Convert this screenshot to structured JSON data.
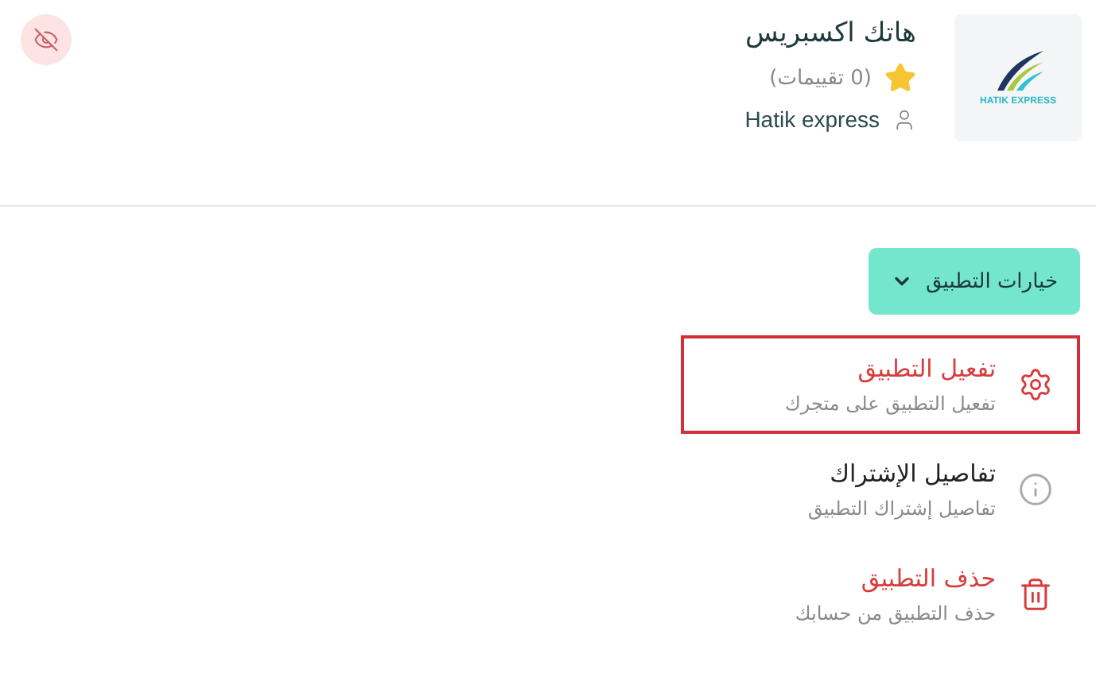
{
  "app": {
    "name": "هاتك اكسبريس",
    "logo_text": "HATIK EXPRESS",
    "stars": 1,
    "rating_text": "(0 تقييمات)",
    "developer": "Hatik express",
    "hidden": true
  },
  "options_button": {
    "label": "خيارات التطبيق",
    "expanded": true
  },
  "menu": [
    {
      "kind": "activate",
      "title": "تفعيل التطبيق",
      "subtitle": "تفعيل التطبيق على متجرك",
      "selected": true
    },
    {
      "kind": "info",
      "title": "تفاصيل الإشتراك",
      "subtitle": "تفاصيل إشتراك التطبيق",
      "selected": false
    },
    {
      "kind": "delete",
      "title": "حذف التطبيق",
      "subtitle": "حذف التطبيق من حسابك",
      "selected": false
    }
  ]
}
